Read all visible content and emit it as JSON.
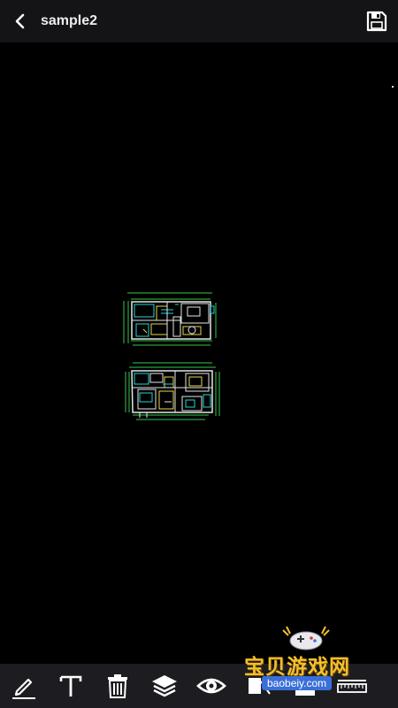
{
  "header": {
    "title": "sample2",
    "back_icon": "back-arrow-icon",
    "save_icon": "save-floppy-icon"
  },
  "toolbar": {
    "tools": [
      {
        "name": "pencil-icon"
      },
      {
        "name": "text-icon"
      },
      {
        "name": "trash-icon"
      },
      {
        "name": "layers-icon"
      },
      {
        "name": "eye-icon"
      },
      {
        "name": "measure-icon"
      },
      {
        "name": "fill-icon"
      },
      {
        "name": "ruler-icon"
      }
    ]
  },
  "watermark": {
    "text": "宝贝游戏网",
    "url": "baobeiy.com"
  },
  "colors": {
    "header_bg": "#141417",
    "toolbar_bg": "#1d1d21",
    "canvas_bg": "#000000",
    "cad_white": "#e6e6e6",
    "cad_cyan": "#27d3d6",
    "cad_yellow": "#e8d84a",
    "cad_green": "#35c84a"
  }
}
